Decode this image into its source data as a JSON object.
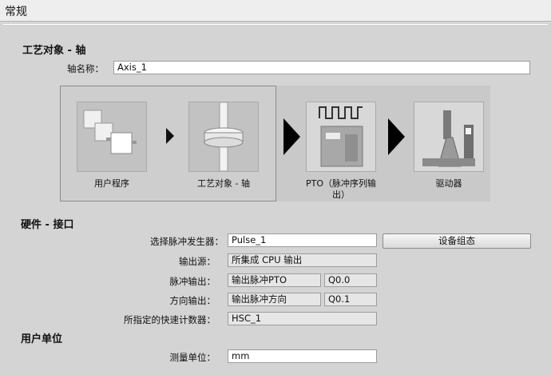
{
  "window": {
    "title": "常规"
  },
  "section_axis": {
    "heading": "工艺对象 - 轴",
    "name_label": "轴名称：",
    "name_value": "Axis_1"
  },
  "flow": {
    "user_program": "用户程序",
    "tech_object": "工艺对象 - 轴",
    "pto_line1": "PTO（脉冲序列输",
    "pto_line2": "出）",
    "drive": "驱动器"
  },
  "section_hw": {
    "heading": "硬件 - 接口",
    "generator_label": "选择脉冲发生器：",
    "generator_value": "Pulse_1",
    "device_config_button": "设备组态",
    "output_source_label": "输出源：",
    "output_source_value": "所集成 CPU 输出",
    "pulse_output_label": "脉冲输出：",
    "pulse_output_value": "输出脉冲PTO",
    "pulse_output_address": "Q0.0",
    "direction_output_label": "方向输出：",
    "direction_output_value": "输出脉冲方向",
    "direction_output_address": "Q0.1",
    "counter_label": "所指定的快速计数器：",
    "counter_value": "HSC_1"
  },
  "section_units": {
    "heading": "用户单位",
    "unit_label": "测量单位：",
    "unit_value": "mm"
  }
}
